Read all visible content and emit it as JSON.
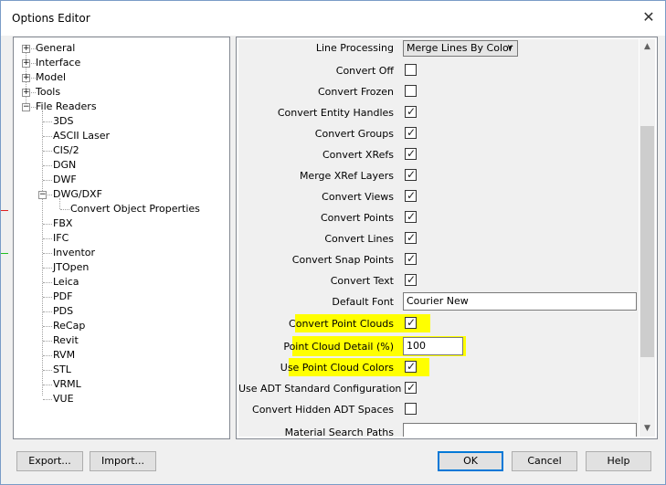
{
  "window": {
    "title": "Options Editor",
    "close_glyph": "✕"
  },
  "tree": {
    "top_items": [
      {
        "label": "General",
        "expander": "+"
      },
      {
        "label": "Interface",
        "expander": "+"
      },
      {
        "label": "Model",
        "expander": "+"
      },
      {
        "label": "Tools",
        "expander": "+"
      },
      {
        "label": "File Readers",
        "expander": "−"
      }
    ],
    "readers": [
      "3DS",
      "ASCII Laser",
      "CIS/2",
      "DGN",
      "DWF",
      "DWG/DXF",
      "FBX",
      "IFC",
      "Inventor",
      "JTOpen",
      "Leica",
      "PDF",
      "PDS",
      "ReCap",
      "Revit",
      "RVM",
      "STL",
      "VRML",
      "VUE"
    ],
    "dwg_child": "Convert Object Properties",
    "dwg_expander": "−"
  },
  "properties": {
    "line_processing_label": "Line Processing",
    "line_processing_value": "Merge Lines By Color",
    "rows": [
      {
        "label": "Convert Off",
        "checked": false
      },
      {
        "label": "Convert Frozen",
        "checked": false
      },
      {
        "label": "Convert Entity Handles",
        "checked": true
      },
      {
        "label": "Convert Groups",
        "checked": true
      },
      {
        "label": "Convert XRefs",
        "checked": true
      },
      {
        "label": "Merge XRef Layers",
        "checked": true
      },
      {
        "label": "Convert Views",
        "checked": true
      },
      {
        "label": "Convert Points",
        "checked": true
      },
      {
        "label": "Convert Lines",
        "checked": true
      },
      {
        "label": "Convert Snap Points",
        "checked": true
      },
      {
        "label": "Convert Text",
        "checked": true
      }
    ],
    "default_font_label": "Default Font",
    "default_font_value": "Courier New",
    "point_clouds_label": "Convert Point Clouds",
    "point_clouds_checked": true,
    "point_cloud_detail_label": "Point Cloud Detail (%)",
    "point_cloud_detail_value": "100",
    "point_cloud_colors_label": "Use Point Cloud Colors",
    "point_cloud_colors_checked": true,
    "adt_config_label": "Use ADT Standard Configuration",
    "adt_config_checked": true,
    "hidden_adt_label": "Convert Hidden ADT Spaces",
    "hidden_adt_checked": false,
    "material_paths_label": "Material Search Paths",
    "material_paths_value": "",
    "highlight_color": "#ffff00"
  },
  "buttons": {
    "export": "Export...",
    "import": "Import...",
    "ok": "OK",
    "cancel": "Cancel",
    "help": "Help"
  },
  "icons": {
    "check": "✓",
    "dropdown": "∨",
    "scroll_up": "▲",
    "scroll_down": "▼"
  }
}
